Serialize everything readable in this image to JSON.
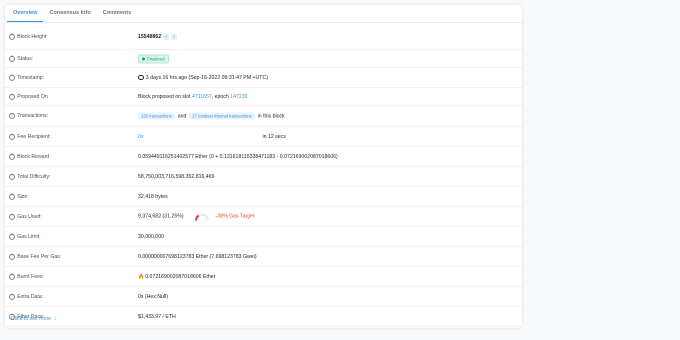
{
  "tabs": [
    "Overview",
    "Consensus Info",
    "Comments"
  ],
  "rows": {
    "block_height": {
      "label": "Block Height:",
      "value": "15548862",
      "prev": "‹",
      "next": "›"
    },
    "status": {
      "label": "Status:",
      "value": "Finalized"
    },
    "timestamp": {
      "label": "Timestamp:",
      "value": "3 days 16 hrs ago (Sep-16-2022 09:31:47 PM +UTC)"
    },
    "proposed_on": {
      "label": "Proposed On",
      "prefix": "Block proposed on slot",
      "slot": "4711657",
      "mid": ", epoch",
      "epoch": "147239"
    },
    "transactions": {
      "label": "Transactions:",
      "tx_chip": "132 transactions",
      "and": "and",
      "internal_chip": "17 contract internal transactions",
      "suffix": "in this block"
    },
    "fee_recipient": {
      "label": "Fee Recipient:",
      "value": "0x",
      "time": "in 12 secs"
    },
    "block_reward": {
      "label": "Block Reward:",
      "value": "0.059449116251402577 Ether (0 + 0.131618115338471183 - 0.072169002087018606)"
    },
    "total_difficulty": {
      "label": "Total Difficulty:",
      "value": "58,750,003,716,598,352,816,469"
    },
    "size": {
      "label": "Size:",
      "value": "32,418 bytes"
    },
    "gas_used": {
      "label": "Gas Used:",
      "value": "9,374,682 (31.25%)",
      "target": "-38% Gas Target",
      "gauge_fraction": 0.3125
    },
    "gas_limit": {
      "label": "Gas Limit:",
      "value": "30,000,000"
    },
    "base_fee": {
      "label": "Base Fee Per Gas:",
      "value": "0.000000007698123783 Ether (7.698123783 Gwei)"
    },
    "burnt_fees": {
      "label": "Burnt Fees:",
      "icon": "flame-icon",
      "value": "0.072169002087018606 Ether"
    },
    "extra_data": {
      "label": "Extra Data:",
      "value": "0x (Hex:Null)"
    },
    "ether_price": {
      "label": "Ether Price:",
      "value": "$1,433.97 / ETH"
    }
  },
  "footer": {
    "label": "Click to see more",
    "arrow": "↓"
  },
  "colors": {
    "accent": "#3498db",
    "success": "#00a186",
    "danger": "#de4437",
    "burn": "#f0823f"
  }
}
